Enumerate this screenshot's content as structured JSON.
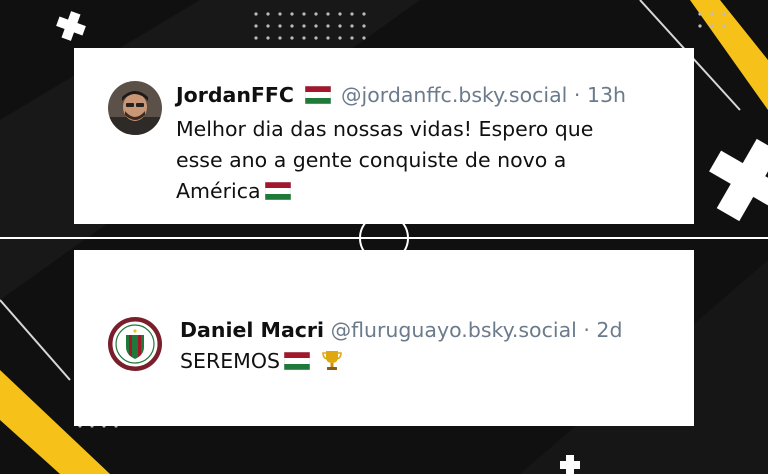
{
  "posts": [
    {
      "name": "JordanFFC",
      "handle": "@jordanffc.bsky.social",
      "separator": "·",
      "time": "13h",
      "text_line1": "Melhor dia das nossas vidas! Espero que",
      "text_line2": "esse ano a gente conquiste de novo a",
      "text_line3": "América",
      "avatar_icon": "person-photo-avatar",
      "flag_icon": "flag-tricolor-icon"
    },
    {
      "name": "Daniel Macri",
      "handle": "@fluruguayo.bsky.social",
      "separator": "·",
      "time": "2d",
      "text": "SEREMOS",
      "avatar_icon": "club-crest-avatar",
      "flag_icon": "flag-tricolor-icon",
      "trophy_icon": "trophy-icon"
    }
  ],
  "colors": {
    "background": "#101010",
    "card": "#ffffff",
    "accent_yellow": "#f6c21a",
    "flag_green": "#1f7a3a",
    "flag_red": "#a3162b",
    "handle_gray": "#6b7b8c"
  }
}
